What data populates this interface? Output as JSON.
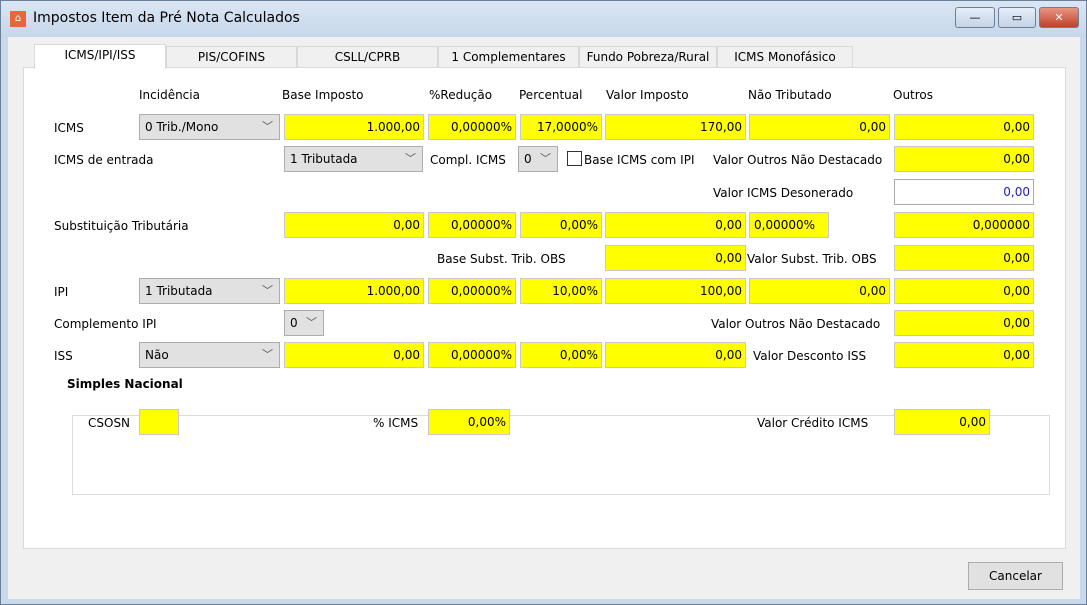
{
  "window": {
    "title": "Impostos Item da Pré Nota Calculados",
    "minimize": "—",
    "maximize": "▭",
    "close": "✕"
  },
  "tabs": [
    "ICMS/IPI/ISS",
    "PIS/COFINS",
    "CSLL/CPRB",
    "1 Complementares",
    "Fundo Pobreza/Rural",
    "ICMS Monofásico"
  ],
  "headers": {
    "incidencia": "Incidência",
    "base": "Base Imposto",
    "reducao": "%Redução",
    "percentual": "Percentual",
    "valor": "Valor Imposto",
    "nao_tributado": "Não Tributado",
    "outros": "Outros"
  },
  "icms": {
    "label": "ICMS",
    "incidencia": "0 Trib./Mono",
    "base": "1.000,00",
    "reducao": "0,00000%",
    "percentual": "17,0000%",
    "valor": "170,00",
    "nao_tributado": "0,00",
    "outros": "0,00"
  },
  "icms_entrada": {
    "label": "ICMS de entrada",
    "tipo": "1 Tributada",
    "compl_label": "Compl. ICMS",
    "compl": "0",
    "base_ipi_label": "Base ICMS com IPI",
    "base_ipi_checked": false,
    "outros_nd_label": "Valor Outros Não Destacado",
    "outros_nd": "0,00"
  },
  "desonerado": {
    "label": "Valor ICMS Desonerado",
    "value": "0,00"
  },
  "st": {
    "label": "Substituição Tributária",
    "base": "0,00",
    "reducao": "0,00000%",
    "percentual": "0,00%",
    "valor": "0,00",
    "mva": "0,00000%",
    "outros": "0,000000"
  },
  "st_obs": {
    "base_label": "Base Subst. Trib. OBS",
    "base": "0,00",
    "valor_label": "Valor Subst. Trib. OBS",
    "valor": "0,00"
  },
  "ipi": {
    "label": "IPI",
    "incidencia": "1 Tributada",
    "base": "1.000,00",
    "reducao": "0,00000%",
    "percentual": "10,00%",
    "valor": "100,00",
    "nao_tributado": "0,00",
    "outros": "0,00"
  },
  "compl_ipi": {
    "label": "Complemento IPI",
    "value": "0",
    "outros_nd_label": "Valor Outros Não Destacado",
    "outros_nd": "0,00"
  },
  "iss": {
    "label": "ISS",
    "incidencia": "Não",
    "base": "0,00",
    "reducao": "0,00000%",
    "percentual": "0,00%",
    "valor": "0,00",
    "desconto_label": "Valor Desconto ISS",
    "desconto": "0,00"
  },
  "simples": {
    "title": "Simples Nacional",
    "csosn_label": "CSOSN",
    "csosn": "",
    "icms_label": "% ICMS",
    "icms": "0,00%",
    "credito_label": "Valor Crédito ICMS",
    "credito": "0,00"
  },
  "buttons": {
    "cancel": "Cancelar"
  },
  "colors": {
    "field": "#ffff00",
    "desonerado_text": "#1c1cc4"
  }
}
